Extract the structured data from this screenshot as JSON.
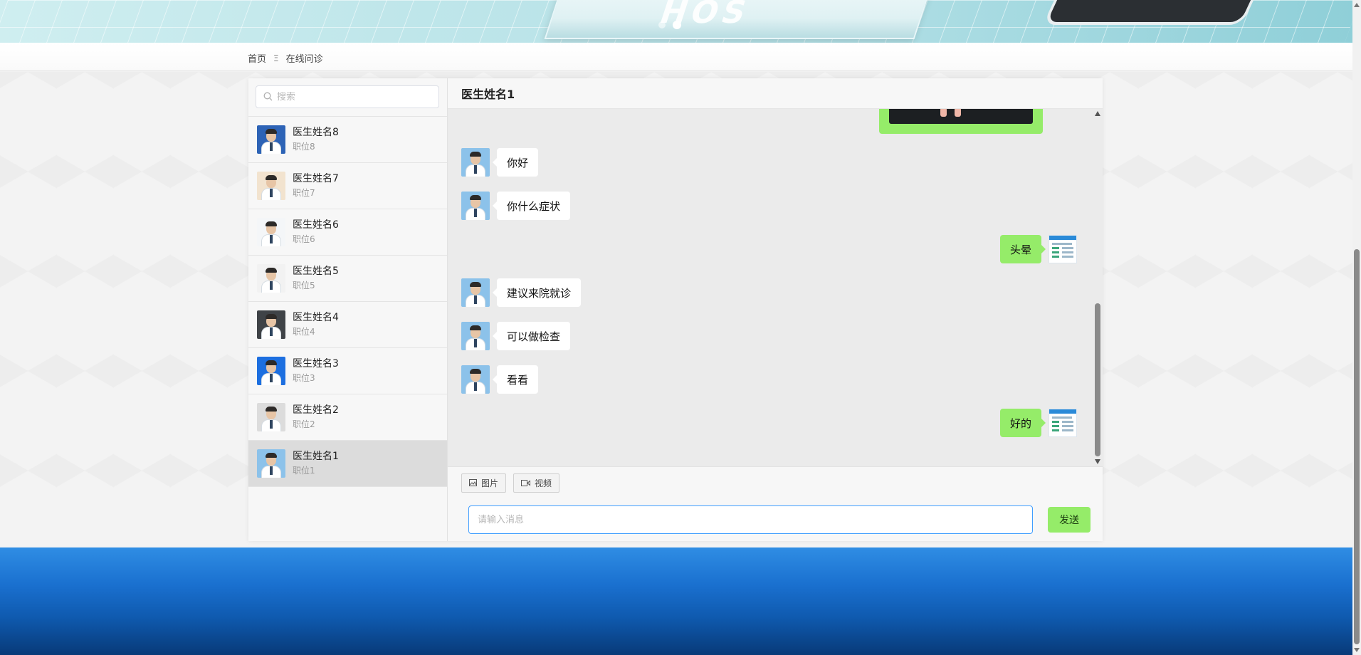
{
  "breadcrumb": {
    "home": "首页",
    "separator": "Ξ",
    "current": "在线问诊"
  },
  "search": {
    "placeholder": "搜索"
  },
  "contacts": [
    {
      "name": "医生姓名8",
      "title": "职位8",
      "avatar_bg": "#2d63b6"
    },
    {
      "name": "医生姓名7",
      "title": "职位7",
      "avatar_bg": "#f2e3cf"
    },
    {
      "name": "医生姓名6",
      "title": "职位6",
      "avatar_bg": "#f4f6f8"
    },
    {
      "name": "医生姓名5",
      "title": "职位5",
      "avatar_bg": "#f2f2f2"
    },
    {
      "name": "医生姓名4",
      "title": "职位4",
      "avatar_bg": "#3f4347"
    },
    {
      "name": "医生姓名3",
      "title": "职位3",
      "avatar_bg": "#1d6fe0"
    },
    {
      "name": "医生姓名2",
      "title": "职位2",
      "avatar_bg": "#dcdcdc"
    },
    {
      "name": "医生姓名1",
      "title": "职位1",
      "avatar_bg": "#8cc2ea"
    }
  ],
  "active_contact": "医生姓名1",
  "chat": {
    "header": "医生姓名1",
    "messages": [
      {
        "from": "doctor",
        "text": "你好"
      },
      {
        "from": "doctor",
        "text": "你什么症状"
      },
      {
        "from": "user",
        "text": "头晕"
      },
      {
        "from": "doctor",
        "text": "建议来院就诊"
      },
      {
        "from": "doctor",
        "text": "可以做检查"
      },
      {
        "from": "doctor",
        "text": "看看"
      },
      {
        "from": "user",
        "text": "好的"
      }
    ]
  },
  "toolbar": {
    "image_label": "图片",
    "video_label": "视频"
  },
  "composer": {
    "placeholder": "请输入消息",
    "value": "",
    "send_label": "发送"
  },
  "colors": {
    "user_bubble": "#95ec69",
    "doctor_bubble": "#ffffff",
    "input_focus": "#409eff",
    "footer_blue": "#1a70cf"
  },
  "icons": {
    "search": "search-icon",
    "image": "image-icon",
    "video": "video-icon"
  }
}
